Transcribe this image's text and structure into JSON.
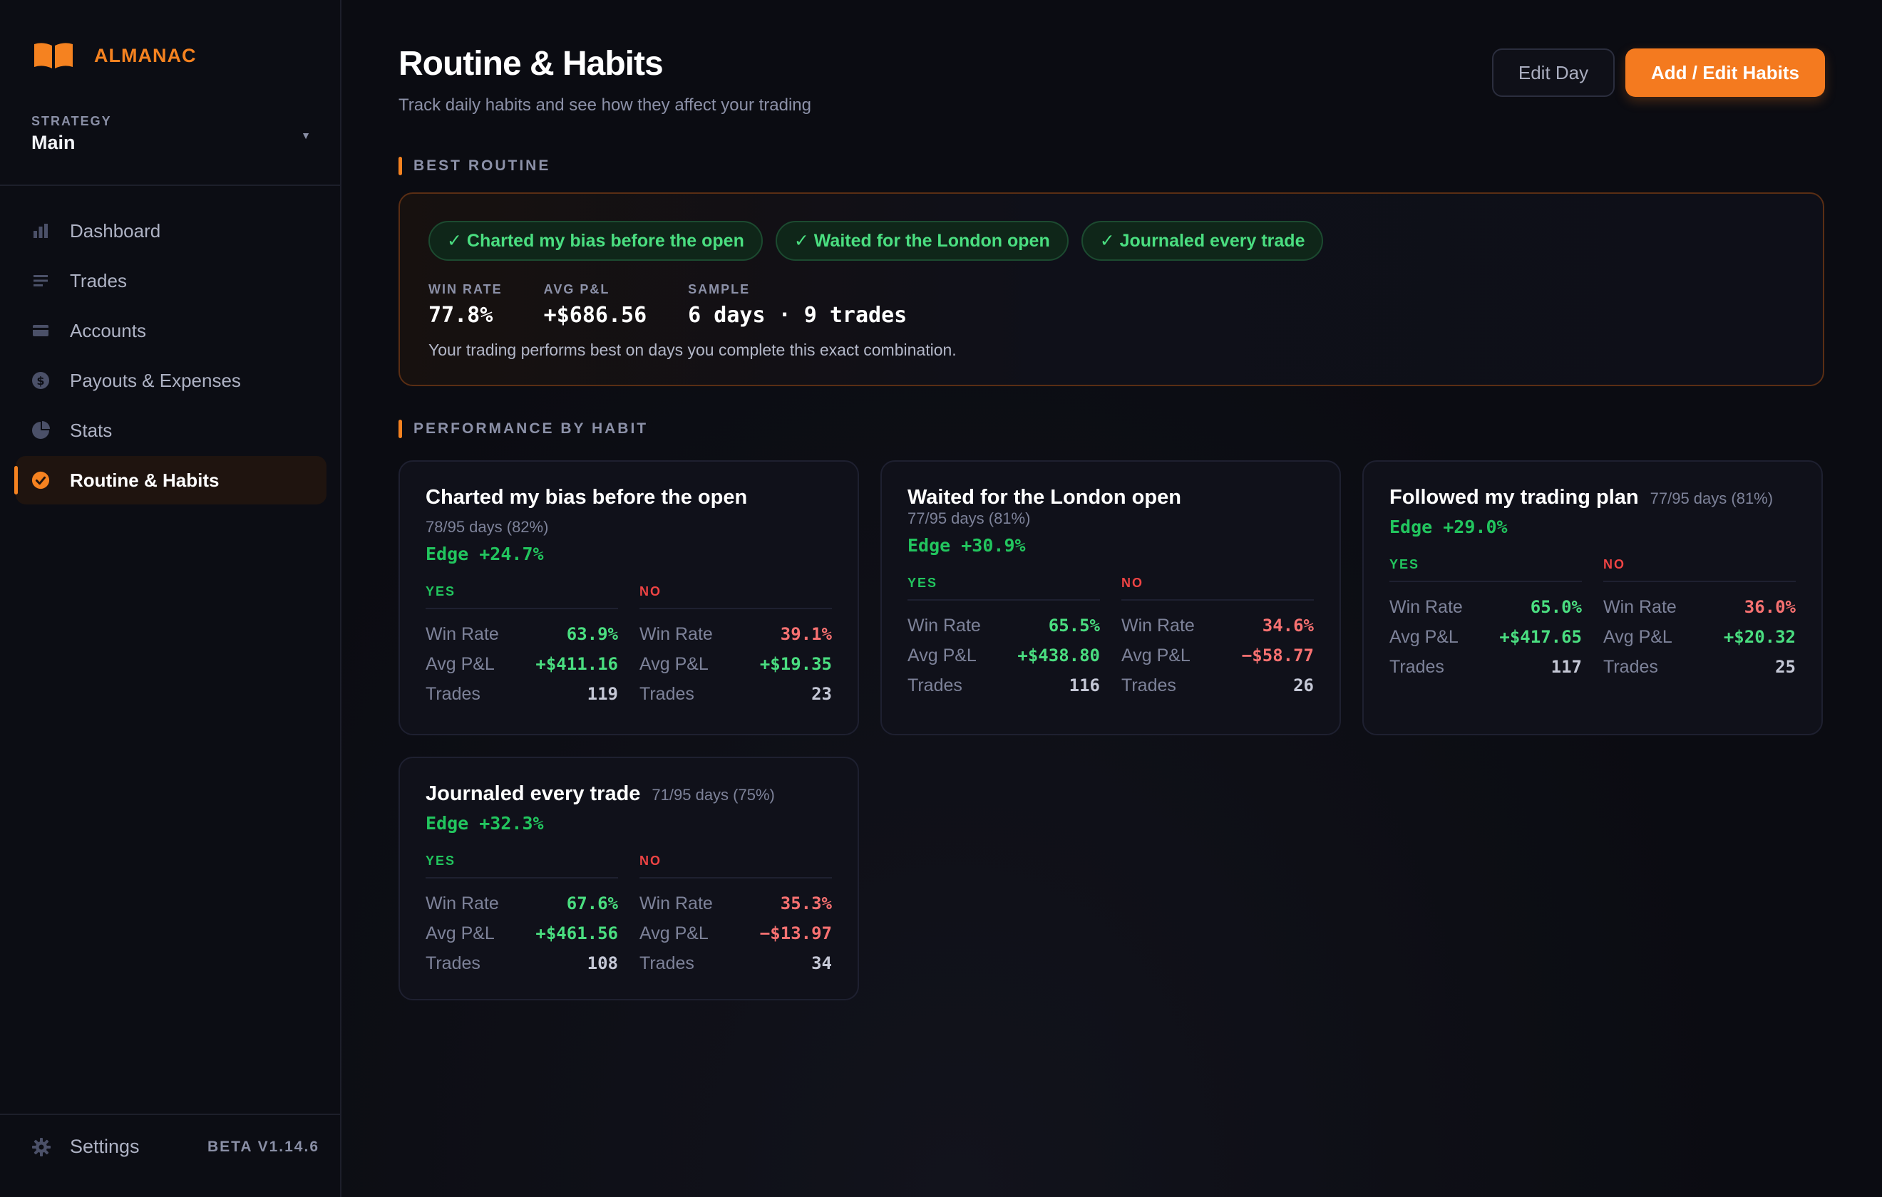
{
  "brand": {
    "name": "ALMANAC",
    "accent": "#f58220"
  },
  "strategy": {
    "label": "STRATEGY",
    "value": "Main"
  },
  "nav": [
    {
      "label": "Dashboard",
      "icon": "bar-chart-icon",
      "active": false
    },
    {
      "label": "Trades",
      "icon": "list-icon",
      "active": false
    },
    {
      "label": "Accounts",
      "icon": "card-icon",
      "active": false
    },
    {
      "label": "Payouts & Expenses",
      "icon": "dollar-coin-icon",
      "active": false
    },
    {
      "label": "Stats",
      "icon": "pie-chart-icon",
      "active": false
    },
    {
      "label": "Routine & Habits",
      "icon": "check-circle-icon",
      "active": true
    }
  ],
  "footer": {
    "settings_label": "Settings",
    "version": "BETA V1.14.6"
  },
  "header": {
    "title": "Routine & Habits",
    "subtitle": "Track daily habits and see how they affect your trading",
    "edit_day_label": "Edit Day",
    "add_label": "Add / Edit Habits"
  },
  "best_routine": {
    "section_label": "BEST ROUTINE",
    "chips": [
      "✓ Charted my bias before the open",
      "✓ Waited for the London open",
      "✓ Journaled every trade"
    ],
    "metrics": [
      {
        "label": "WIN RATE",
        "value": "77.8%"
      },
      {
        "label": "AVG P&L",
        "value": "+$686.56"
      },
      {
        "label": "SAMPLE",
        "value": "6 days · 9 trades"
      }
    ],
    "note": "Your trading performs best on days you complete this exact combination."
  },
  "performance": {
    "section_label": "PERFORMANCE BY HABIT",
    "yes_label": "YES",
    "no_label": "NO",
    "stat_names": {
      "win_rate": "Win Rate",
      "avg_pnl": "Avg P&L",
      "trades": "Trades"
    },
    "habits": [
      {
        "title": "Charted my bias before the open",
        "days": "78/95 days (82%)",
        "edge": "Edge +24.7%",
        "yes": {
          "win_rate": "63.9%",
          "avg_pnl": "+$411.16",
          "trades": "119"
        },
        "no": {
          "win_rate": "39.1%",
          "avg_pnl": "+$19.35",
          "trades": "23"
        }
      },
      {
        "title": "Waited for the London open",
        "days": "77/95 days (81%)",
        "edge": "Edge +30.9%",
        "yes": {
          "win_rate": "65.5%",
          "avg_pnl": "+$438.80",
          "trades": "116"
        },
        "no": {
          "win_rate": "34.6%",
          "avg_pnl": "−$58.77",
          "trades": "26"
        }
      },
      {
        "title": "Followed my trading plan",
        "days": "77/95 days (81%)",
        "edge": "Edge +29.0%",
        "yes": {
          "win_rate": "65.0%",
          "avg_pnl": "+$417.65",
          "trades": "117"
        },
        "no": {
          "win_rate": "36.0%",
          "avg_pnl": "+$20.32",
          "trades": "25"
        }
      },
      {
        "title": "Journaled every trade",
        "days": "71/95 days (75%)",
        "edge": "Edge +32.3%",
        "yes": {
          "win_rate": "67.6%",
          "avg_pnl": "+$461.56",
          "trades": "108"
        },
        "no": {
          "win_rate": "35.3%",
          "avg_pnl": "−$13.97",
          "trades": "34"
        }
      }
    ]
  },
  "colors": {
    "positive": "#4ade80",
    "negative": "#f87171",
    "edge": "#22c55e",
    "accent_button": "#f47a1f"
  }
}
